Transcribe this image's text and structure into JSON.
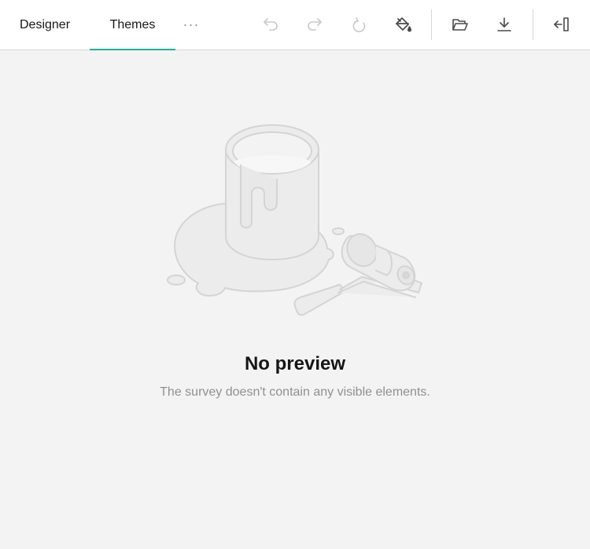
{
  "tabs": {
    "designer": "Designer",
    "themes": "Themes",
    "more": "···"
  },
  "toolbar": {
    "undo_icon": "undo-icon",
    "redo_icon": "redo-icon",
    "reset_icon": "reset-icon",
    "paint_icon": "paint-bucket-icon",
    "open_icon": "folder-open-icon",
    "download_icon": "download-icon",
    "collapse_icon": "collapse-panel-icon"
  },
  "preview": {
    "title": "No preview",
    "message": "The survey doesn't contain any visible elements."
  },
  "colors": {
    "accent": "#19b394",
    "background": "#f3f3f3",
    "toolbar_background": "#ffffff",
    "text": "#161616",
    "muted": "#909090"
  }
}
